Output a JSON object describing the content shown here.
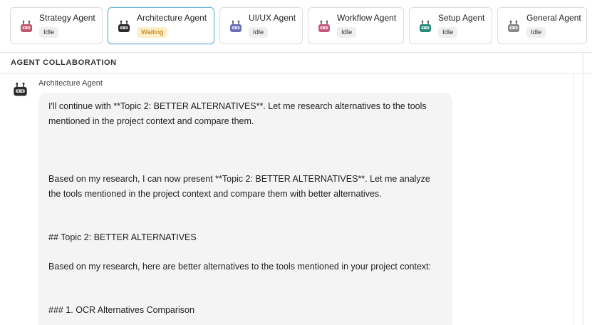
{
  "agents": [
    {
      "name": "Strategy Agent",
      "status": "Idle",
      "icon": "robot-icon",
      "color": "#c2566f"
    },
    {
      "name": "Architecture Agent",
      "status": "Waiting",
      "icon": "robot-icon",
      "color": "#2b2b2b"
    },
    {
      "name": "UI/UX Agent",
      "status": "Idle",
      "icon": "robot-icon",
      "color": "#6b6fb5"
    },
    {
      "name": "Workflow Agent",
      "status": "Idle",
      "icon": "robot-icon",
      "color": "#c45a7d"
    },
    {
      "name": "Setup Agent",
      "status": "Idle",
      "icon": "robot-icon",
      "color": "#2a8a78"
    },
    {
      "name": "General Agent",
      "status": "Idle",
      "icon": "robot-icon",
      "color": "#8a8a8a"
    }
  ],
  "section": {
    "title": "AGENT COLLABORATION"
  },
  "message": {
    "sender": "Architecture Agent",
    "paragraphs": [
      "I'll continue with **Topic 2: BETTER ALTERNATIVES**. Let me research alternatives to the tools mentioned in the project context and compare them.",
      "Based on my research, I can now present **Topic 2: BETTER ALTERNATIVES**. Let me analyze the tools mentioned in the project context and compare them with better alternatives.",
      "## Topic 2: BETTER ALTERNATIVES",
      "Based on my research, here are better alternatives to the tools mentioned in your project context:",
      "### 1. OCR Alternatives Comparison"
    ]
  }
}
